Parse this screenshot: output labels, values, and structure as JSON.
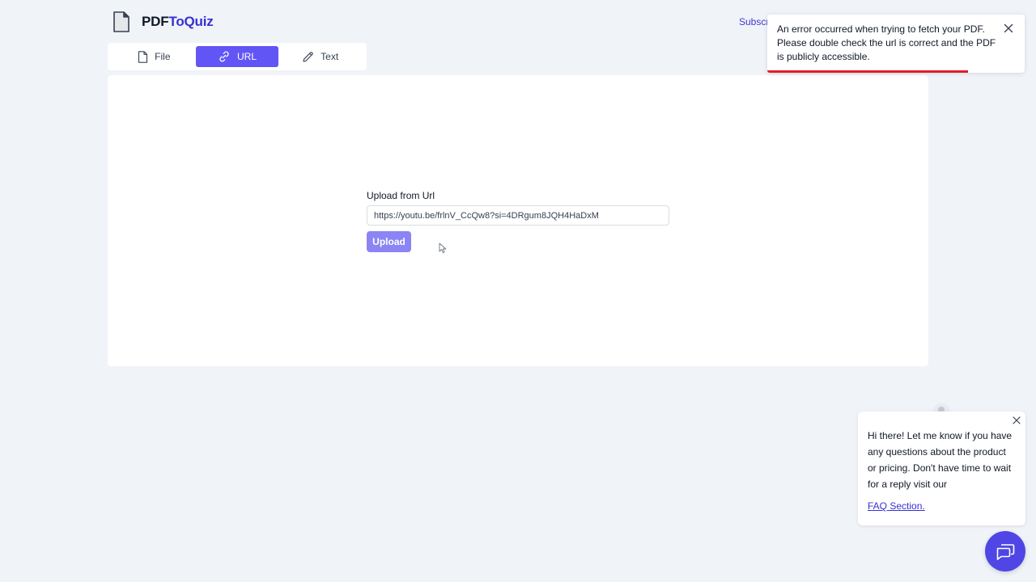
{
  "brand": {
    "prefix": "PDF",
    "accent": "ToQuiz"
  },
  "header": {
    "subscribe_label": "Subscr"
  },
  "tabs": [
    {
      "label": "File",
      "icon": "file-icon",
      "active": false
    },
    {
      "label": "URL",
      "icon": "link-icon",
      "active": true
    },
    {
      "label": "Text",
      "icon": "pencil-icon",
      "active": false
    }
  ],
  "upload": {
    "label": "Upload from Url",
    "url_value": "https://youtu.be/frlnV_CcQw8?si=4DRgum8JQH4HaDxM",
    "button_label": "Upload"
  },
  "toast": {
    "message": "An error occurred when trying to fetch your PDF. Please double check the url is correct and the PDF is publicly accessible.",
    "progress": 0.78,
    "color": "#e11d2a"
  },
  "chat": {
    "message": "Hi there! Let me know if you have any questions about the product or pricing. Don't have time to wait for a reply visit our",
    "link_label": "FAQ Section."
  },
  "colors": {
    "accent": "#6155f5",
    "accent_disabled": "#8b84f4",
    "brand_blue": "#3730d4",
    "background": "#f0f3f8"
  }
}
